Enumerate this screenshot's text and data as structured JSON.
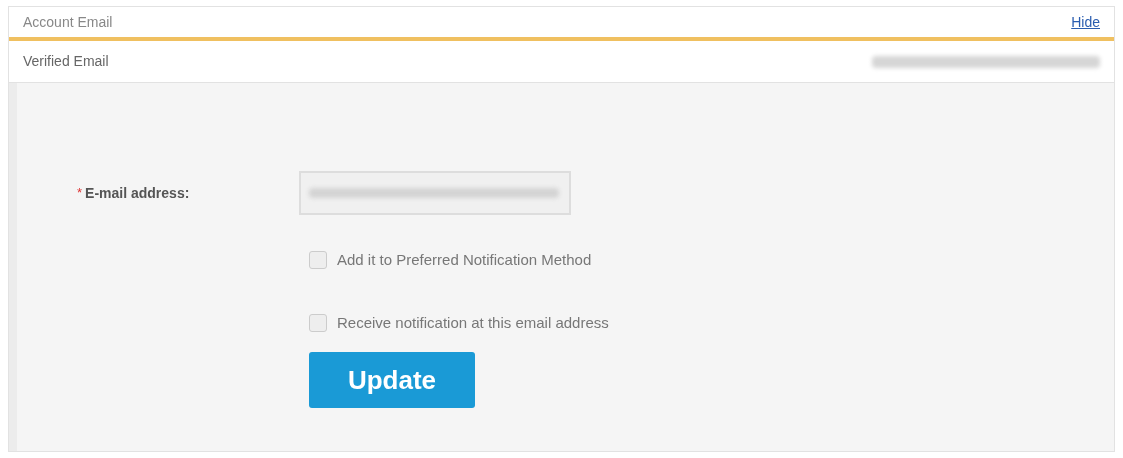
{
  "header": {
    "title": "Account Email",
    "link": "Hide"
  },
  "verified": {
    "label": "Verified Email"
  },
  "form": {
    "required_mark": "*",
    "label": "E-mail address:",
    "options": [
      {
        "label": "Add it to Preferred Notification Method",
        "checked": false
      },
      {
        "label": "Receive notification at this email address",
        "checked": false
      }
    ],
    "button": "Update"
  }
}
